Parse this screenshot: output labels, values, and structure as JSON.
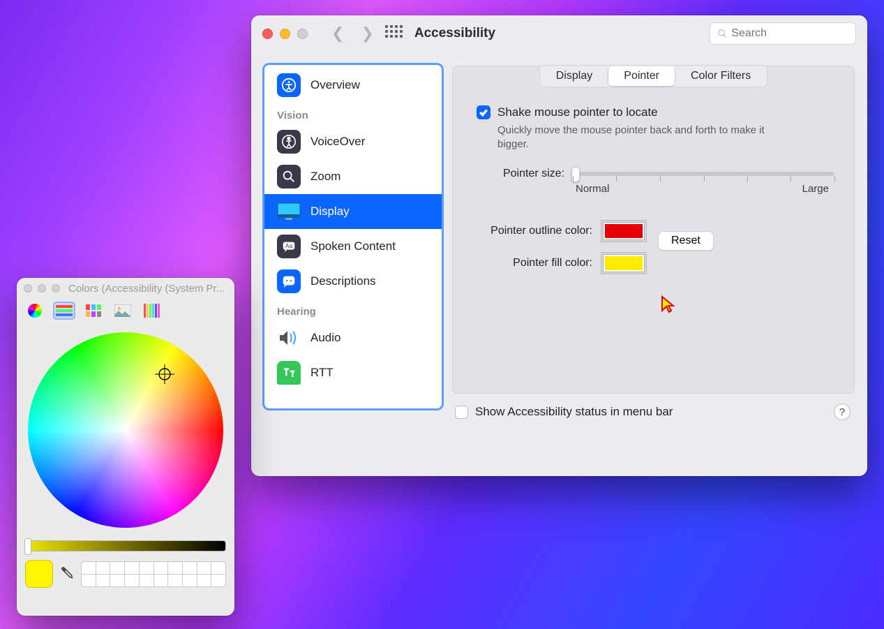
{
  "main_window": {
    "title": "Accessibility",
    "search_placeholder": "Search",
    "footer_label": "Show Accessibility status in menu bar",
    "help_glyph": "?"
  },
  "sidebar": {
    "items": [
      {
        "label": "Overview",
        "icon": "overview",
        "kind": "item"
      },
      {
        "label": "Vision",
        "kind": "heading"
      },
      {
        "label": "VoiceOver",
        "icon": "voiceover",
        "kind": "item"
      },
      {
        "label": "Zoom",
        "icon": "zoom",
        "kind": "item"
      },
      {
        "label": "Display",
        "icon": "display",
        "kind": "item",
        "selected": true
      },
      {
        "label": "Spoken Content",
        "icon": "spoken",
        "kind": "item"
      },
      {
        "label": "Descriptions",
        "icon": "descriptions",
        "kind": "item"
      },
      {
        "label": "Hearing",
        "kind": "heading"
      },
      {
        "label": "Audio",
        "icon": "audio",
        "kind": "item"
      },
      {
        "label": "RTT",
        "icon": "rtt",
        "kind": "item"
      }
    ]
  },
  "tabs": {
    "0": "Display",
    "1": "Pointer",
    "2": "Color Filters",
    "active": 1
  },
  "pointer": {
    "shake_label": "Shake mouse pointer to locate",
    "shake_checked": true,
    "shake_help": "Quickly move the mouse pointer back and forth to make it bigger.",
    "size_label": "Pointer size:",
    "size_min": "Normal",
    "size_max": "Large",
    "outline_label": "Pointer outline color:",
    "fill_label": "Pointer fill color:",
    "outline_color": "#e60000",
    "fill_color": "#ffec00",
    "reset_label": "Reset"
  },
  "colors_window": {
    "title": "Colors (Accessibility (System Pr...",
    "selected_swatch": "#fff600"
  }
}
